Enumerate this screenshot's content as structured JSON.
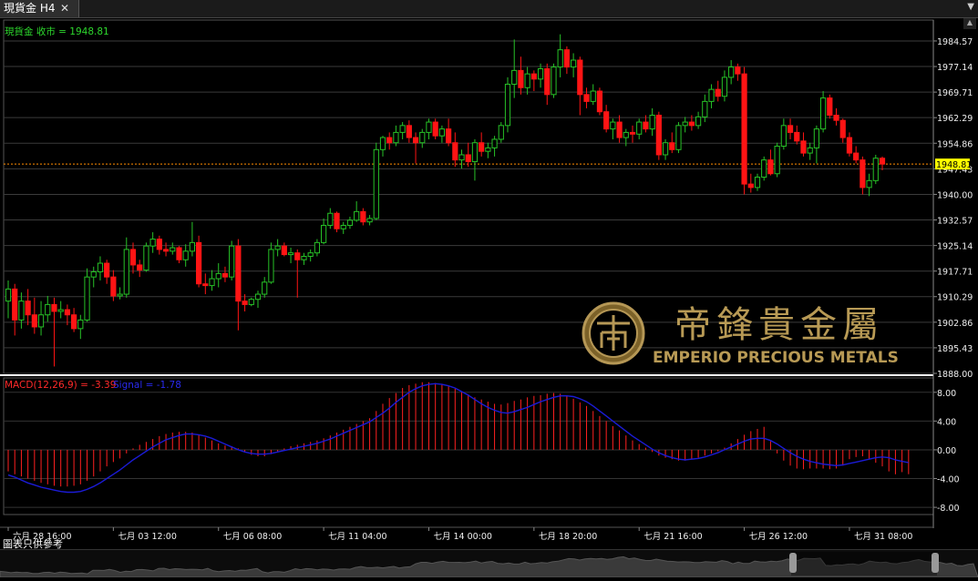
{
  "tab": {
    "title": "現貨金 H4",
    "close": "✕"
  },
  "main": {
    "legend": "現貨金 收市 = 1948.81",
    "y_ticks": [
      {
        "v": 1984.57,
        "t": "1984.57"
      },
      {
        "v": 1977.14,
        "t": "1977.14"
      },
      {
        "v": 1969.71,
        "t": "1969.71"
      },
      {
        "v": 1962.29,
        "t": "1962.29"
      },
      {
        "v": 1954.86,
        "t": "1954.86"
      },
      {
        "v": 1947.43,
        "t": "1947.43"
      },
      {
        "v": 1940.0,
        "t": "1940.00"
      },
      {
        "v": 1932.57,
        "t": "1932.57"
      },
      {
        "v": 1925.14,
        "t": "1925.14"
      },
      {
        "v": 1917.71,
        "t": "1917.71"
      },
      {
        "v": 1910.29,
        "t": "1910.29"
      },
      {
        "v": 1902.86,
        "t": "1902.86"
      },
      {
        "v": 1895.43,
        "t": "1895.43"
      },
      {
        "v": 1888.0,
        "t": "1888.00"
      }
    ],
    "last_price": 1948.81,
    "last_price_label": "1948.81",
    "up_color": "#27c227",
    "down_color": "#ff1414",
    "price_line_color": "#ff8c00"
  },
  "macd": {
    "legend_macd": "MACD(12,26,9) = -3.39",
    "legend_signal": "Signal = -1.78",
    "macd_color": "#ff2020",
    "signal_color": "#1b1bd6",
    "y_ticks": [
      {
        "v": 8,
        "t": "8.00"
      },
      {
        "v": 4,
        "t": "4.00"
      },
      {
        "v": 0,
        "t": "0.00"
      },
      {
        "v": -4,
        "t": "-4.00"
      },
      {
        "v": -8,
        "t": "-8.00"
      }
    ]
  },
  "time_labels": [
    "六月 28 16:00",
    "七月 03 12:00",
    "七月 06 08:00",
    "七月 11 04:00",
    "七月 14 00:00",
    "七月 18 20:00",
    "七月 21 16:00",
    "七月 26 12:00",
    "七月 31 08:00"
  ],
  "footer_note": "圖表只供參考",
  "watermark": {
    "cn": "帝鋒貴金屬",
    "en": "EMPERIO PRECIOUS METALS"
  },
  "chart_data": {
    "type": "candlestick",
    "symbol": "現貨金",
    "timeframe": "H4",
    "close_label": "收市",
    "ylim": [
      1888.0,
      1988.0
    ],
    "candles": [
      {
        "o": 1909.0,
        "h": 1915.0,
        "l": 1904.0,
        "c": 1912.5
      },
      {
        "o": 1912.5,
        "h": 1914.0,
        "l": 1899.0,
        "c": 1903.5
      },
      {
        "o": 1903.5,
        "h": 1911.5,
        "l": 1901.0,
        "c": 1909.0
      },
      {
        "o": 1909.0,
        "h": 1912.5,
        "l": 1902.0,
        "c": 1905.0
      },
      {
        "o": 1905.0,
        "h": 1910.0,
        "l": 1899.5,
        "c": 1901.5
      },
      {
        "o": 1901.5,
        "h": 1909.0,
        "l": 1899.0,
        "c": 1905.0
      },
      {
        "o": 1905.0,
        "h": 1910.5,
        "l": 1903.0,
        "c": 1908.0
      },
      {
        "o": 1908.0,
        "h": 1910.0,
        "l": 1890.0,
        "c": 1906.0
      },
      {
        "o": 1906.0,
        "h": 1909.0,
        "l": 1904.0,
        "c": 1906.5
      },
      {
        "o": 1906.5,
        "h": 1908.0,
        "l": 1902.0,
        "c": 1905.0
      },
      {
        "o": 1905.0,
        "h": 1907.0,
        "l": 1900.0,
        "c": 1901.0
      },
      {
        "o": 1901.0,
        "h": 1905.0,
        "l": 1898.0,
        "c": 1903.5
      },
      {
        "o": 1903.5,
        "h": 1918.5,
        "l": 1903.0,
        "c": 1916.0
      },
      {
        "o": 1916.0,
        "h": 1919.0,
        "l": 1913.0,
        "c": 1917.5
      },
      {
        "o": 1917.5,
        "h": 1922.0,
        "l": 1915.0,
        "c": 1920.0
      },
      {
        "o": 1920.0,
        "h": 1921.0,
        "l": 1914.0,
        "c": 1916.0
      },
      {
        "o": 1916.0,
        "h": 1918.0,
        "l": 1909.0,
        "c": 1910.5
      },
      {
        "o": 1910.5,
        "h": 1913.0,
        "l": 1909.5,
        "c": 1911.0
      },
      {
        "o": 1911.0,
        "h": 1927.5,
        "l": 1910.0,
        "c": 1924.0
      },
      {
        "o": 1924.0,
        "h": 1926.0,
        "l": 1917.0,
        "c": 1919.5
      },
      {
        "o": 1919.5,
        "h": 1921.0,
        "l": 1916.0,
        "c": 1918.0
      },
      {
        "o": 1918.0,
        "h": 1926.0,
        "l": 1917.5,
        "c": 1925.0
      },
      {
        "o": 1925.0,
        "h": 1929.0,
        "l": 1923.0,
        "c": 1927.0
      },
      {
        "o": 1927.0,
        "h": 1928.0,
        "l": 1922.5,
        "c": 1924.0
      },
      {
        "o": 1924.0,
        "h": 1926.0,
        "l": 1922.0,
        "c": 1923.5
      },
      {
        "o": 1923.5,
        "h": 1926.0,
        "l": 1922.5,
        "c": 1924.5
      },
      {
        "o": 1924.5,
        "h": 1925.0,
        "l": 1920.0,
        "c": 1921.0
      },
      {
        "o": 1921.0,
        "h": 1925.5,
        "l": 1919.0,
        "c": 1923.5
      },
      {
        "o": 1923.5,
        "h": 1932.0,
        "l": 1922.0,
        "c": 1926.0
      },
      {
        "o": 1926.0,
        "h": 1928.0,
        "l": 1913.0,
        "c": 1914.0
      },
      {
        "o": 1914.0,
        "h": 1917.0,
        "l": 1911.0,
        "c": 1913.5
      },
      {
        "o": 1913.5,
        "h": 1918.0,
        "l": 1912.0,
        "c": 1915.5
      },
      {
        "o": 1915.5,
        "h": 1920.0,
        "l": 1913.0,
        "c": 1917.0
      },
      {
        "o": 1917.0,
        "h": 1919.0,
        "l": 1914.5,
        "c": 1916.0
      },
      {
        "o": 1916.0,
        "h": 1926.5,
        "l": 1915.0,
        "c": 1925.0
      },
      {
        "o": 1925.0,
        "h": 1927.0,
        "l": 1900.5,
        "c": 1909.0
      },
      {
        "o": 1909.0,
        "h": 1911.0,
        "l": 1906.0,
        "c": 1908.0
      },
      {
        "o": 1908.0,
        "h": 1910.0,
        "l": 1907.5,
        "c": 1909.5
      },
      {
        "o": 1909.5,
        "h": 1912.0,
        "l": 1907.0,
        "c": 1911.0
      },
      {
        "o": 1911.0,
        "h": 1916.0,
        "l": 1910.0,
        "c": 1914.5
      },
      {
        "o": 1914.5,
        "h": 1926.0,
        "l": 1914.0,
        "c": 1924.0
      },
      {
        "o": 1924.0,
        "h": 1927.0,
        "l": 1922.0,
        "c": 1925.0
      },
      {
        "o": 1925.0,
        "h": 1926.0,
        "l": 1922.0,
        "c": 1922.5
      },
      {
        "o": 1922.5,
        "h": 1924.5,
        "l": 1920.0,
        "c": 1923.0
      },
      {
        "o": 1923.0,
        "h": 1924.0,
        "l": 1910.0,
        "c": 1921.0
      },
      {
        "o": 1921.0,
        "h": 1923.0,
        "l": 1919.5,
        "c": 1922.0
      },
      {
        "o": 1922.0,
        "h": 1924.0,
        "l": 1920.5,
        "c": 1923.0
      },
      {
        "o": 1923.0,
        "h": 1927.0,
        "l": 1922.0,
        "c": 1926.0
      },
      {
        "o": 1926.0,
        "h": 1933.0,
        "l": 1925.5,
        "c": 1931.0
      },
      {
        "o": 1931.0,
        "h": 1936.0,
        "l": 1930.0,
        "c": 1934.5
      },
      {
        "o": 1934.5,
        "h": 1935.0,
        "l": 1929.0,
        "c": 1930.0
      },
      {
        "o": 1930.0,
        "h": 1932.0,
        "l": 1928.5,
        "c": 1931.0
      },
      {
        "o": 1931.0,
        "h": 1933.5,
        "l": 1930.0,
        "c": 1932.5
      },
      {
        "o": 1932.5,
        "h": 1938.0,
        "l": 1932.0,
        "c": 1935.0
      },
      {
        "o": 1935.0,
        "h": 1936.0,
        "l": 1931.0,
        "c": 1932.0
      },
      {
        "o": 1932.0,
        "h": 1934.0,
        "l": 1931.0,
        "c": 1933.0
      },
      {
        "o": 1933.0,
        "h": 1955.0,
        "l": 1932.5,
        "c": 1953.0
      },
      {
        "o": 1953.0,
        "h": 1957.0,
        "l": 1951.0,
        "c": 1956.5
      },
      {
        "o": 1956.5,
        "h": 1958.0,
        "l": 1953.0,
        "c": 1955.0
      },
      {
        "o": 1955.0,
        "h": 1960.0,
        "l": 1954.0,
        "c": 1958.0
      },
      {
        "o": 1958.0,
        "h": 1961.0,
        "l": 1956.0,
        "c": 1960.0
      },
      {
        "o": 1960.0,
        "h": 1961.5,
        "l": 1955.0,
        "c": 1956.5
      },
      {
        "o": 1956.5,
        "h": 1958.0,
        "l": 1949.0,
        "c": 1955.0
      },
      {
        "o": 1955.0,
        "h": 1959.0,
        "l": 1953.5,
        "c": 1958.0
      },
      {
        "o": 1958.0,
        "h": 1962.0,
        "l": 1956.0,
        "c": 1961.0
      },
      {
        "o": 1961.0,
        "h": 1962.0,
        "l": 1956.0,
        "c": 1957.0
      },
      {
        "o": 1957.0,
        "h": 1960.0,
        "l": 1955.0,
        "c": 1959.0
      },
      {
        "o": 1959.0,
        "h": 1962.0,
        "l": 1954.0,
        "c": 1955.0
      },
      {
        "o": 1955.0,
        "h": 1958.0,
        "l": 1948.0,
        "c": 1950.0
      },
      {
        "o": 1950.0,
        "h": 1953.0,
        "l": 1947.5,
        "c": 1951.5
      },
      {
        "o": 1951.5,
        "h": 1955.0,
        "l": 1948.0,
        "c": 1949.5
      },
      {
        "o": 1949.5,
        "h": 1956.0,
        "l": 1944.0,
        "c": 1955.0
      },
      {
        "o": 1955.0,
        "h": 1958.0,
        "l": 1951.0,
        "c": 1952.5
      },
      {
        "o": 1952.5,
        "h": 1955.0,
        "l": 1950.5,
        "c": 1953.5
      },
      {
        "o": 1953.5,
        "h": 1957.0,
        "l": 1951.0,
        "c": 1956.0
      },
      {
        "o": 1956.0,
        "h": 1961.0,
        "l": 1955.0,
        "c": 1960.0
      },
      {
        "o": 1960.0,
        "h": 1974.0,
        "l": 1958.0,
        "c": 1972.0
      },
      {
        "o": 1972.0,
        "h": 1985.0,
        "l": 1968.0,
        "c": 1976.0
      },
      {
        "o": 1976.0,
        "h": 1980.0,
        "l": 1969.0,
        "c": 1971.0
      },
      {
        "o": 1971.0,
        "h": 1977.0,
        "l": 1969.0,
        "c": 1975.0
      },
      {
        "o": 1975.0,
        "h": 1976.0,
        "l": 1970.0,
        "c": 1973.5
      },
      {
        "o": 1973.5,
        "h": 1978.0,
        "l": 1971.0,
        "c": 1976.5
      },
      {
        "o": 1976.5,
        "h": 1978.0,
        "l": 1966.0,
        "c": 1969.0
      },
      {
        "o": 1969.0,
        "h": 1978.0,
        "l": 1968.0,
        "c": 1977.0
      },
      {
        "o": 1977.0,
        "h": 1986.5,
        "l": 1974.0,
        "c": 1982.0
      },
      {
        "o": 1982.0,
        "h": 1983.0,
        "l": 1975.0,
        "c": 1977.0
      },
      {
        "o": 1977.0,
        "h": 1981.0,
        "l": 1974.0,
        "c": 1979.0
      },
      {
        "o": 1979.0,
        "h": 1980.0,
        "l": 1963.0,
        "c": 1969.0
      },
      {
        "o": 1969.0,
        "h": 1971.0,
        "l": 1965.0,
        "c": 1967.0
      },
      {
        "o": 1967.0,
        "h": 1972.0,
        "l": 1966.0,
        "c": 1970.0
      },
      {
        "o": 1970.0,
        "h": 1971.0,
        "l": 1963.0,
        "c": 1964.0
      },
      {
        "o": 1964.0,
        "h": 1966.0,
        "l": 1958.0,
        "c": 1959.0
      },
      {
        "o": 1959.0,
        "h": 1962.0,
        "l": 1956.0,
        "c": 1961.0
      },
      {
        "o": 1961.0,
        "h": 1963.0,
        "l": 1955.0,
        "c": 1956.5
      },
      {
        "o": 1956.5,
        "h": 1959.0,
        "l": 1954.0,
        "c": 1958.0
      },
      {
        "o": 1958.0,
        "h": 1960.0,
        "l": 1955.0,
        "c": 1957.5
      },
      {
        "o": 1957.5,
        "h": 1962.0,
        "l": 1956.0,
        "c": 1961.0
      },
      {
        "o": 1961.0,
        "h": 1963.0,
        "l": 1958.0,
        "c": 1959.0
      },
      {
        "o": 1959.0,
        "h": 1965.0,
        "l": 1957.0,
        "c": 1963.0
      },
      {
        "o": 1963.0,
        "h": 1964.0,
        "l": 1950.0,
        "c": 1951.5
      },
      {
        "o": 1951.5,
        "h": 1956.0,
        "l": 1950.0,
        "c": 1955.0
      },
      {
        "o": 1955.0,
        "h": 1958.0,
        "l": 1952.0,
        "c": 1953.0
      },
      {
        "o": 1953.0,
        "h": 1961.0,
        "l": 1952.0,
        "c": 1960.0
      },
      {
        "o": 1960.0,
        "h": 1962.5,
        "l": 1958.0,
        "c": 1961.0
      },
      {
        "o": 1961.0,
        "h": 1963.0,
        "l": 1958.5,
        "c": 1960.0
      },
      {
        "o": 1960.0,
        "h": 1964.0,
        "l": 1959.0,
        "c": 1962.5
      },
      {
        "o": 1962.5,
        "h": 1969.0,
        "l": 1961.0,
        "c": 1967.0
      },
      {
        "o": 1967.0,
        "h": 1972.0,
        "l": 1965.0,
        "c": 1970.5
      },
      {
        "o": 1970.5,
        "h": 1973.0,
        "l": 1967.0,
        "c": 1968.5
      },
      {
        "o": 1968.5,
        "h": 1976.0,
        "l": 1967.0,
        "c": 1974.0
      },
      {
        "o": 1974.0,
        "h": 1979.0,
        "l": 1972.0,
        "c": 1977.0
      },
      {
        "o": 1977.0,
        "h": 1978.0,
        "l": 1973.0,
        "c": 1975.0
      },
      {
        "o": 1975.0,
        "h": 1977.0,
        "l": 1940.0,
        "c": 1943.0
      },
      {
        "o": 1943.0,
        "h": 1946.0,
        "l": 1940.5,
        "c": 1942.0
      },
      {
        "o": 1942.0,
        "h": 1946.0,
        "l": 1941.0,
        "c": 1945.0
      },
      {
        "o": 1945.0,
        "h": 1951.0,
        "l": 1944.0,
        "c": 1950.0
      },
      {
        "o": 1950.0,
        "h": 1953.0,
        "l": 1945.5,
        "c": 1946.0
      },
      {
        "o": 1946.0,
        "h": 1955.0,
        "l": 1945.0,
        "c": 1954.0
      },
      {
        "o": 1954.0,
        "h": 1962.0,
        "l": 1953.0,
        "c": 1960.0
      },
      {
        "o": 1960.0,
        "h": 1962.0,
        "l": 1956.0,
        "c": 1958.0
      },
      {
        "o": 1958.0,
        "h": 1960.0,
        "l": 1954.5,
        "c": 1955.5
      },
      {
        "o": 1955.5,
        "h": 1958.0,
        "l": 1951.0,
        "c": 1952.0
      },
      {
        "o": 1952.0,
        "h": 1955.0,
        "l": 1950.0,
        "c": 1953.5
      },
      {
        "o": 1953.5,
        "h": 1960.0,
        "l": 1949.0,
        "c": 1959.0
      },
      {
        "o": 1959.0,
        "h": 1970.0,
        "l": 1958.0,
        "c": 1968.0
      },
      {
        "o": 1968.0,
        "h": 1969.0,
        "l": 1962.0,
        "c": 1963.0
      },
      {
        "o": 1963.0,
        "h": 1965.0,
        "l": 1960.0,
        "c": 1961.5
      },
      {
        "o": 1961.5,
        "h": 1962.0,
        "l": 1955.0,
        "c": 1956.5
      },
      {
        "o": 1956.5,
        "h": 1958.0,
        "l": 1951.0,
        "c": 1952.0
      },
      {
        "o": 1952.0,
        "h": 1954.0,
        "l": 1949.0,
        "c": 1950.0
      },
      {
        "o": 1950.0,
        "h": 1951.0,
        "l": 1940.0,
        "c": 1942.0
      },
      {
        "o": 1942.0,
        "h": 1946.0,
        "l": 1939.5,
        "c": 1944.0
      },
      {
        "o": 1944.0,
        "h": 1951.5,
        "l": 1943.0,
        "c": 1950.5
      },
      {
        "o": 1950.5,
        "h": 1951.0,
        "l": 1947.0,
        "c": 1948.81
      }
    ],
    "indicator": {
      "name": "MACD(12,26,9)",
      "macd_last": -3.39,
      "signal_last": -1.78,
      "ylim": [
        -9,
        10
      ],
      "histogram": [
        -3,
        -3.4,
        -3.7,
        -4,
        -4.3,
        -4.6,
        -4.8,
        -5,
        -5.1,
        -5.1,
        -5,
        -4.8,
        -4.3,
        -3.7,
        -3,
        -2.3,
        -1.7,
        -1.2,
        -0.5,
        0.2,
        0.7,
        1.1,
        1.5,
        1.9,
        2.2,
        2.4,
        2.5,
        2.5,
        2.4,
        2.1,
        1.7,
        1.3,
        0.9,
        0.6,
        0.5,
        0.2,
        -0.3,
        -0.7,
        -0.9,
        -0.9,
        -0.6,
        -0.2,
        0.2,
        0.5,
        0.7,
        0.9,
        1.1,
        1.3,
        1.6,
        2,
        2.4,
        2.8,
        3.2,
        3.6,
        4,
        4.4,
        5.4,
        6.4,
        7.2,
        7.9,
        8.6,
        9.0,
        9.2,
        9.4,
        9.4,
        9.3,
        9.1,
        8.8,
        8.5,
        8.1,
        7.7,
        7.3,
        7.0,
        6.7,
        6.4,
        6.3,
        6.5,
        6.8,
        7.0,
        7.3,
        7.5,
        7.6,
        7.8,
        7.9,
        7.8,
        7.5,
        7.1,
        6.6,
        6.1,
        5.4,
        4.7,
        4.0,
        3.3,
        2.7,
        2.0,
        1.3,
        0.8,
        0.3,
        -0.3,
        -0.8,
        -1.1,
        -1.3,
        -1.5,
        -1.5,
        -1.3,
        -1.1,
        -0.8,
        -0.5,
        -0.2,
        0.3,
        0.9,
        1.5,
        2.1,
        2.6,
        2.9,
        3.2,
        1.2,
        -0.5,
        -1.5,
        -2.2,
        -2.6,
        -2.7,
        -2.6,
        -2.6,
        -2.6,
        -2.7,
        -2.6,
        -2.2,
        -1.3,
        -1.0,
        -0.9,
        -1.3,
        -1.8,
        -2.3,
        -3.0,
        -3.4,
        -3.1,
        -3.39
      ],
      "signal": [
        -3.5,
        -3.8,
        -4.2,
        -4.6,
        -4.9,
        -5.2,
        -5.4,
        -5.6,
        -5.8,
        -5.9,
        -5.9,
        -5.8,
        -5.5,
        -5.1,
        -4.6,
        -4.0,
        -3.4,
        -2.8,
        -2.1,
        -1.4,
        -0.8,
        -0.2,
        0.4,
        0.9,
        1.4,
        1.7,
        2.0,
        2.2,
        2.2,
        2.1,
        1.9,
        1.6,
        1.2,
        0.8,
        0.4,
        0.0,
        -0.3,
        -0.5,
        -0.6,
        -0.6,
        -0.5,
        -0.3,
        -0.1,
        0.1,
        0.3,
        0.5,
        0.7,
        0.9,
        1.2,
        1.5,
        1.9,
        2.3,
        2.7,
        3.1,
        3.5,
        3.9,
        4.5,
        5.1,
        5.8,
        6.6,
        7.3,
        8.0,
        8.5,
        8.9,
        9.1,
        9.2,
        9.1,
        8.9,
        8.6,
        8.1,
        7.6,
        7.0,
        6.4,
        5.9,
        5.5,
        5.2,
        5.1,
        5.3,
        5.6,
        5.9,
        6.3,
        6.7,
        7.0,
        7.3,
        7.5,
        7.5,
        7.4,
        7.1,
        6.7,
        6.1,
        5.4,
        4.7,
        4.0,
        3.3,
        2.6,
        1.9,
        1.3,
        0.7,
        0.1,
        -0.4,
        -0.8,
        -1.1,
        -1.3,
        -1.4,
        -1.3,
        -1.2,
        -1.0,
        -0.7,
        -0.4,
        0.0,
        0.4,
        0.8,
        1.2,
        1.5,
        1.6,
        1.6,
        1.3,
        0.8,
        0.2,
        -0.4,
        -0.9,
        -1.3,
        -1.6,
        -1.8,
        -2.0,
        -2.1,
        -2.2,
        -2.1,
        -1.9,
        -1.7,
        -1.5,
        -1.3,
        -1.1,
        -1.0,
        -1.1,
        -1.4,
        -1.6,
        -1.78
      ]
    }
  }
}
